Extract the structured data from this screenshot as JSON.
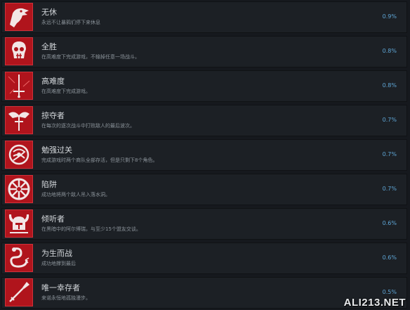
{
  "achievements": [
    {
      "title": "无休",
      "desc": "永远不让暴鸦们停下来休息",
      "pct": "0.9%",
      "icon": "raven-head-icon"
    },
    {
      "title": "全胜",
      "desc": "在高难度下完成游戏，不输掉任意一场战斗。",
      "pct": "0.8%",
      "icon": "skull-icon"
    },
    {
      "title": "高难度",
      "desc": "在高难度下完成游戏。",
      "pct": "0.8%",
      "icon": "sword-icon"
    },
    {
      "title": "掠夺者",
      "desc": "在每次的逐次战斗中打败敌人的最后波次。",
      "pct": "0.7%",
      "icon": "eagle-sword-icon"
    },
    {
      "title": "勉强过关",
      "desc": "完成游戏时两个商队全部存活，但是只剩下8个角色。",
      "pct": "0.7%",
      "icon": "knot-icon"
    },
    {
      "title": "陷阱",
      "desc": "成功地将两个敌人吊入落水洞。",
      "pct": "0.7%",
      "icon": "trap-wheel-icon"
    },
    {
      "title": "倾听者",
      "desc": "在黑暗中的阿尔博瑞，与至少15个盟友交谈。",
      "pct": "0.6%",
      "icon": "horned-helmet-icon"
    },
    {
      "title": "为生而战",
      "desc": "成功地撑到最后",
      "pct": "0.6%",
      "icon": "serpent-icon"
    },
    {
      "title": "唯一幸存者",
      "desc": "来诺永恒地孤独漫步。",
      "pct": "0.5%",
      "icon": "spear-icon"
    }
  ],
  "watermark": "ALI213.NET"
}
